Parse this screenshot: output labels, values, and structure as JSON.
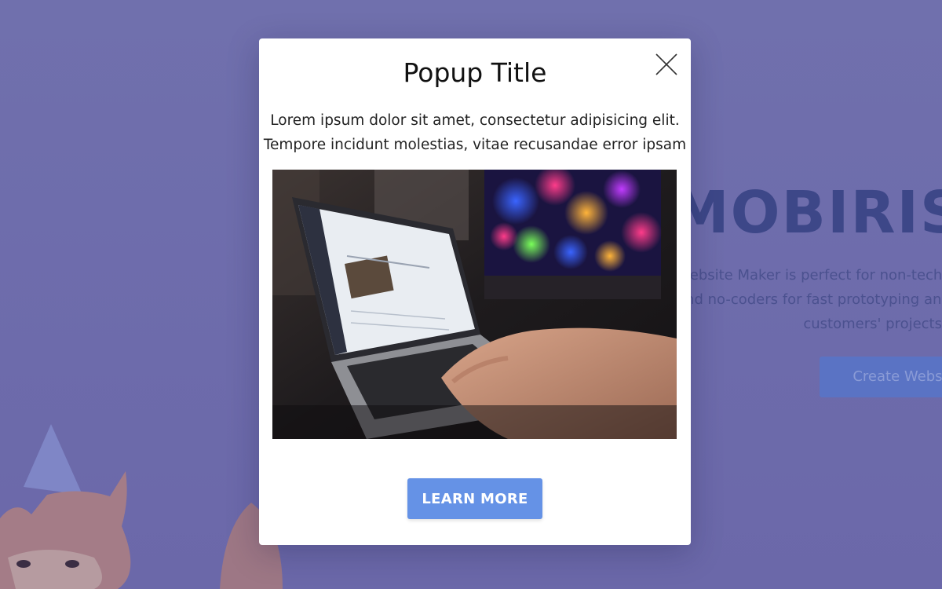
{
  "background": {
    "hero_title": "MOBIRISE",
    "hero_text_lines": [
      "Website Maker is perfect for non-techies",
      "and no-coders for fast prototyping and small",
      "customers' projects"
    ],
    "create_button_label": "Create Website"
  },
  "popup": {
    "title": "Popup Title",
    "text_lines": [
      "Lorem ipsum dolor sit amet, consectetur adipisicing elit.",
      "Tempore incidunt molestias, vitae recusandae error ipsam"
    ],
    "image_icon": "laptop-photo",
    "close_icon": "close-icon",
    "button_label": "LEARN MORE",
    "button_color": "#6592e6"
  },
  "colors": {
    "overlay": "#6c6bab",
    "hero_title": "#3d4788",
    "accent": "#6592e6"
  }
}
